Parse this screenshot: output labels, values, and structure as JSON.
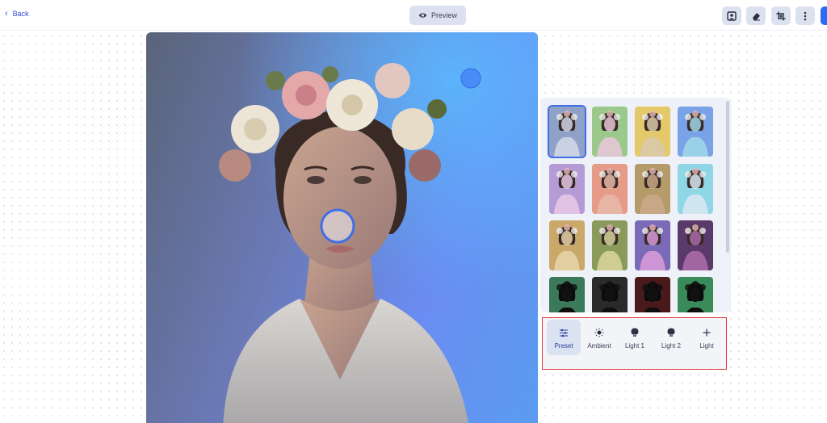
{
  "header": {
    "back_label": "Back",
    "preview_label": "Preview",
    "tools": [
      {
        "name": "crop-face-icon"
      },
      {
        "name": "eraser-icon"
      },
      {
        "name": "transform-icon"
      },
      {
        "name": "more-icon"
      }
    ]
  },
  "presets": {
    "selected_index": 0,
    "thumbnails": [
      {
        "bg": "#8fa1c7",
        "tint": "#cfd6e6"
      },
      {
        "bg": "#9bc98c",
        "tint": "#e6c6d6"
      },
      {
        "bg": "#e3c96a",
        "tint": "#d9c9a8"
      },
      {
        "bg": "#7aa2e6",
        "tint": "#9fd6e8"
      },
      {
        "bg": "#b59bd6",
        "tint": "#e6c6e6"
      },
      {
        "bg": "#e69a88",
        "tint": "#e6b8a8"
      },
      {
        "bg": "#b59a6a",
        "tint": "#c9a888"
      },
      {
        "bg": "#8fd6e6",
        "tint": "#d6e8f2"
      },
      {
        "bg": "#c9a86a",
        "tint": "#e6d2a8"
      },
      {
        "bg": "#8a9a5a",
        "tint": "#d6d29a"
      },
      {
        "bg": "#7a6ab8",
        "tint": "#d69ad6"
      },
      {
        "bg": "#5a3a6a",
        "tint": "#a86aa8"
      },
      {
        "bg": "#3a7a5a",
        "tint": "#1a1a1a"
      },
      {
        "bg": "#2a2a2a",
        "tint": "#1a1a1a"
      },
      {
        "bg": "#4a1a1a",
        "tint": "#1a1a1a"
      },
      {
        "bg": "#3a8a5a",
        "tint": "#1a1a1a"
      }
    ]
  },
  "lighting_tabs": [
    {
      "label": "Preset",
      "icon": "sliders-icon",
      "active": true
    },
    {
      "label": "Ambient",
      "icon": "sun-icon",
      "active": false
    },
    {
      "label": "Light 1",
      "icon": "bulb-icon",
      "active": false
    },
    {
      "label": "Light 2",
      "icon": "bulb-icon",
      "active": false
    },
    {
      "label": "Light",
      "icon": "plus-icon",
      "active": false
    }
  ],
  "colors": {
    "accent": "#2f6af5",
    "highlight_border": "#e23b3b",
    "light_handle": "#4a8cf5"
  }
}
